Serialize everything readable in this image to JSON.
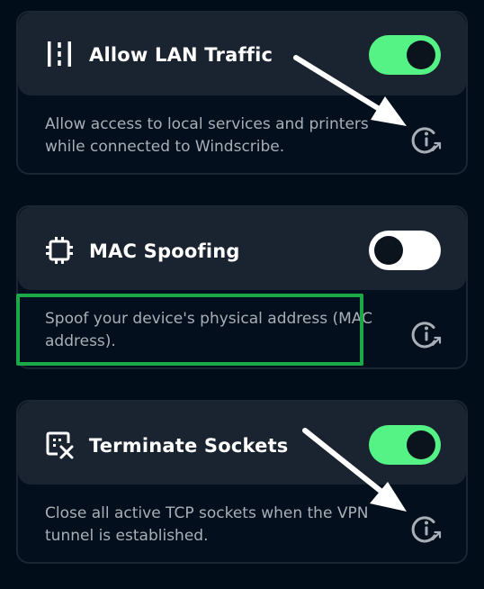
{
  "settings": [
    {
      "title": "Allow LAN Traffic",
      "icon": "lan-icon",
      "enabled": true,
      "description": "Allow access to local services and printers while connected to Windscribe."
    },
    {
      "title": "MAC Spoofing",
      "icon": "chip-icon",
      "enabled": false,
      "description": "Spoof your device's physical address (MAC address)."
    },
    {
      "title": "Terminate Sockets",
      "icon": "terminate-sockets-icon",
      "enabled": true,
      "description": "Close all active TCP sockets when the VPN tunnel is established."
    }
  ],
  "colors": {
    "toggle_on": "#55f386",
    "toggle_off": "#ffffff",
    "highlight": "#1ba847",
    "background": "#020d1a",
    "card_header": "#1a2330"
  }
}
